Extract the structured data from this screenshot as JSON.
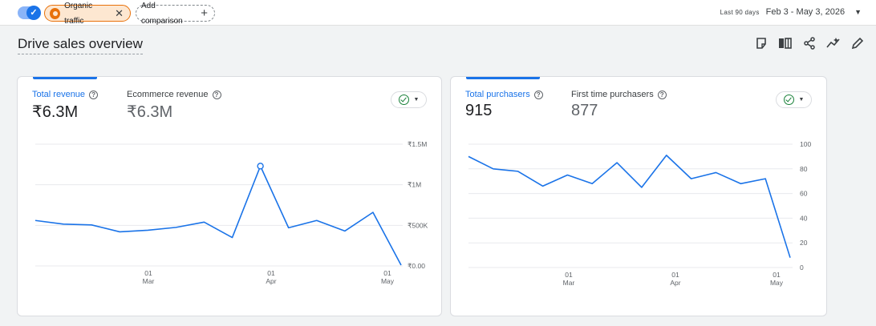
{
  "topbar": {
    "comparison_toggle_on": true,
    "segment_chip": {
      "label": "Organic traffic",
      "color": "#e8710a"
    },
    "add_comparison_label": "Add comparison",
    "date_range": {
      "period_label": "Last 90 days",
      "dates": "Feb 3 - May 3, 2026"
    }
  },
  "page": {
    "title": "Drive sales overview",
    "toolbar_icons": [
      "customize-report-icon",
      "compare-columns-icon",
      "share-icon",
      "insights-icon",
      "edit-icon"
    ]
  },
  "cards": [
    {
      "metrics": [
        {
          "label": "Total revenue",
          "value": "₹6.3M",
          "active": true
        },
        {
          "label": "Ecommerce revenue",
          "value": "₹6.3M",
          "active": false
        }
      ],
      "chart_data": {
        "type": "line",
        "series": [
          {
            "values": [
              560000,
              515000,
              505000,
              420000,
              440000,
              475000,
              540000,
              350000,
              1230000,
              470000,
              560000,
              430000,
              660000,
              10000
            ]
          }
        ],
        "ylim": [
          0,
          1500000
        ],
        "y_ticks": [
          "₹0.00",
          "₹500K",
          "₹1M",
          "₹1.5M"
        ],
        "x_ticks": [
          {
            "day": "01",
            "month": "Mar"
          },
          {
            "day": "01",
            "month": "Apr"
          },
          {
            "day": "01",
            "month": "May"
          }
        ],
        "highlight_index": 8,
        "grid": true,
        "color": "#1a73e8"
      }
    },
    {
      "metrics": [
        {
          "label": "Total purchasers",
          "value": "915",
          "active": true
        },
        {
          "label": "First time purchasers",
          "value": "877",
          "active": false
        }
      ],
      "chart_data": {
        "type": "line",
        "series": [
          {
            "values": [
              90,
              80,
              78,
              66,
              75,
              68,
              85,
              65,
              91,
              72,
              77,
              68,
              72,
              8
            ]
          }
        ],
        "ylim": [
          0,
          100
        ],
        "y_ticks": [
          "0",
          "20",
          "40",
          "60",
          "80",
          "100"
        ],
        "x_ticks": [
          {
            "day": "01",
            "month": "Mar"
          },
          {
            "day": "01",
            "month": "Apr"
          },
          {
            "day": "01",
            "month": "May"
          }
        ],
        "grid": true,
        "color": "#1a73e8"
      }
    }
  ]
}
